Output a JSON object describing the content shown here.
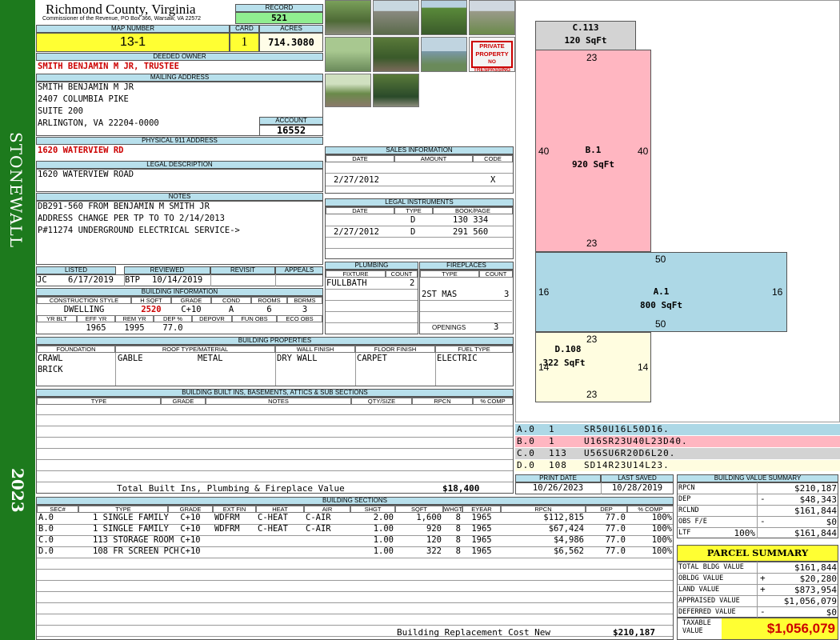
{
  "sidebar": {
    "district": "STONEWALL",
    "year": "2023"
  },
  "header": {
    "county": "Richmond County, Virginia",
    "subtitle": "Commissioner of the Revenue, PO Box 366, Warsaw, VA 22572"
  },
  "record": {
    "label": "RECORD",
    "value": "521"
  },
  "map": {
    "label": "MAP NUMBER",
    "value": "13-1"
  },
  "card": {
    "label": "CARD",
    "value": "1"
  },
  "acres": {
    "label": "ACRES",
    "value": "714.3080"
  },
  "owner": {
    "label": "DEEDED OWNER",
    "value": "SMITH BENJAMIN M JR, TRUSTEE"
  },
  "mailing": {
    "label": "MAILING ADDRESS",
    "lines": [
      "SMITH BENJAMIN M JR",
      "2407 COLUMBIA PIKE",
      "SUITE 200",
      "ARLINGTON, VA 22204-0000"
    ]
  },
  "account": {
    "label": "ACCOUNT",
    "value": "16552"
  },
  "physical": {
    "label": "PHYSICAL 911 ADDRESS",
    "value": "1620 WATERVIEW RD"
  },
  "legal": {
    "label": "LEGAL DESCRIPTION",
    "value": "1620 WATERVIEW ROAD"
  },
  "notes": {
    "label": "NOTES",
    "lines": [
      "DB291-560 FROM BENJAMIN M SMITH JR",
      "ADDRESS CHANGE PER TP TO TO 2/14/2013",
      "P#11274 UNDERGROUND ELECTRICAL SERVICE->"
    ]
  },
  "review": {
    "listed_label": "LISTED",
    "reviewed_label": "REVIEWED",
    "revisit_label": "REVISIT",
    "appeals_label": "APPEALS",
    "listed_by": "JC",
    "listed_date": "6/17/2019",
    "reviewed_by": "BTP",
    "reviewed_date": "10/14/2019"
  },
  "building_info": {
    "label": "BUILDING INFORMATION",
    "h": [
      "CONSTRUCTION STYLE",
      "H SQFT",
      "GRADE",
      "COND",
      "ROOMS",
      "BDRMS"
    ],
    "v": [
      "DWELLING",
      "2520",
      "C+10",
      "A",
      "6",
      "3"
    ],
    "h2": [
      "YR BLT",
      "EFF YR",
      "REM YR",
      "DEP %",
      "DEPOVR",
      "FUN OBS",
      "ECO OBS"
    ],
    "v2": [
      "",
      "1965",
      "1995",
      "77.0",
      "",
      "",
      ""
    ]
  },
  "properties": {
    "label": "BUILDING PROPERTIES",
    "h": [
      "FOUNDATION",
      "ROOF TYPE/MATERIAL",
      "WALL FINISH",
      "FLOOR FINISH",
      "FUEL TYPE"
    ],
    "foundation": [
      "CRAWL",
      "BRICK"
    ],
    "roof_type": "GABLE",
    "roof_material": "METAL",
    "wall": "DRY WALL",
    "floor": "CARPET",
    "fuel": "ELECTRIC"
  },
  "builtins": {
    "label": "BUILDING BUILT INS, BASEMENTS, ATTICS & SUB SECTIONS",
    "h": [
      "TYPE",
      "GRADE",
      "NOTES",
      "QTY/SIZE",
      "RPCN",
      "% COMP"
    ],
    "total_label": "Total Built Ins, Plumbing & Fireplace Value",
    "total": "$18,400"
  },
  "sales": {
    "label": "SALES INFORMATION",
    "h": [
      "DATE",
      "AMOUNT",
      "CODE"
    ],
    "date": "2/27/2012",
    "code": "X"
  },
  "instruments": {
    "label": "LEGAL INSTRUMENTS",
    "h": [
      "DATE",
      "TYPE",
      "BOOK/PAGE"
    ],
    "rows": [
      [
        "",
        "D",
        "130 334"
      ],
      [
        "2/27/2012",
        "D",
        "291 560"
      ]
    ]
  },
  "plumbing": {
    "label": "PLUMBING",
    "h": [
      "FIXTURE",
      "COUNT"
    ],
    "fixture": "FULLBATH",
    "count": "2"
  },
  "fireplaces": {
    "label": "FIREPLACES",
    "h": [
      "TYPE",
      "COUNT"
    ],
    "type": "2ST MAS",
    "count": "3",
    "openings_label": "OPENINGS",
    "openings": "3"
  },
  "sketch": {
    "c": {
      "code": "C.113",
      "area": "120 SqFt"
    },
    "b": {
      "code": "B.1",
      "area": "920 SqFt",
      "top": "23",
      "bottom": "23",
      "left": "40",
      "right": "40"
    },
    "a": {
      "code": "A.1",
      "area": "800 SqFt",
      "top": "50",
      "bottom": "50",
      "left": "16",
      "right": "16"
    },
    "d": {
      "code": "D.108",
      "area": "322 SqFt",
      "top": "23",
      "bottom": "23",
      "left": "14",
      "right": "14"
    }
  },
  "vectors": [
    {
      "id": "A.0",
      "num": "1",
      "path": "SR50U16L50D16.",
      "color": "#add8e6"
    },
    {
      "id": "B.0",
      "num": "1",
      "path": "U16SR23U40L23D40.",
      "color": "#ffb6c1"
    },
    {
      "id": "C.0",
      "num": "113",
      "path": "U56SU6R20D6L20.",
      "color": "#d3d3d3"
    },
    {
      "id": "D.0",
      "num": "108",
      "path": "SD14R23U14L23.",
      "color": "#fffde0"
    }
  ],
  "print": {
    "print_label": "PRINT DATE",
    "print_date": "10/26/2023",
    "saved_label": "LAST SAVED",
    "saved_date": "10/28/2019"
  },
  "sections": {
    "label": "BUILDING SECTIONS",
    "h": [
      "SEC#",
      "TYPE",
      "GRADE",
      "EXT FIN",
      "HEAT",
      "AIR",
      "SHGT",
      "SQFT",
      "WHGT",
      "EYEAR",
      "RPCN",
      "DEP",
      "% COMP"
    ],
    "rows": [
      [
        "A.0",
        "1 SINGLE FAMILY",
        "C+10",
        "WDFRM",
        "C-HEAT",
        "C-AIR",
        "2.00",
        "1,600",
        "8",
        "1965",
        "$112,815",
        "77.0",
        "100%"
      ],
      [
        "B.0",
        "1 SINGLE FAMILY",
        "C+10",
        "WDFRM",
        "C-HEAT",
        "C-AIR",
        "1.00",
        "920",
        "8",
        "1965",
        "$67,424",
        "77.0",
        "100%"
      ],
      [
        "C.0",
        "113 STORAGE ROOM",
        "C+10",
        "",
        "",
        "",
        "1.00",
        "120",
        "8",
        "1965",
        "$4,986",
        "77.0",
        "100%"
      ],
      [
        "D.0",
        "108 FR SCREEN PCH",
        "C+10",
        "",
        "",
        "",
        "1.00",
        "322",
        "8",
        "1965",
        "$6,562",
        "77.0",
        "100%"
      ]
    ],
    "brcn_label": "Building Replacement Cost New",
    "brcn": "$210,187"
  },
  "bvs": {
    "label": "BUILDING VALUE SUMMARY",
    "rpcn_label": "RPCN",
    "rpcn": "$210,187",
    "dep_label": "DEP",
    "dep_sign": "-",
    "dep": "$48,343",
    "rclnd_label": "RCLND",
    "rclnd": "$161,844",
    "obs_label": "OBS F/E",
    "obs_sign": "-",
    "obs": "$0",
    "ltf_label": "LTF",
    "ltf_pct": "100%",
    "ltf": "$161,844"
  },
  "parcel": {
    "label": "PARCEL SUMMARY",
    "rows": [
      [
        "TOTAL BLDG VALUE",
        "",
        "$161,844"
      ],
      [
        "OBLDG VALUE",
        "+",
        "$20,280"
      ],
      [
        "LAND VALUE",
        "+",
        "$873,954"
      ],
      [
        "APPRAISED VALUE",
        "",
        "$1,056,079"
      ],
      [
        "DEFERRED VALUE",
        "-",
        "$0"
      ]
    ],
    "taxable_label1": "TAXABLE",
    "taxable_label2": "VALUE",
    "taxable": "$1,056,079"
  },
  "photos": {
    "sign_text": [
      "PRIVATE",
      "PROPERTY",
      "NO TRESPASSING"
    ]
  }
}
